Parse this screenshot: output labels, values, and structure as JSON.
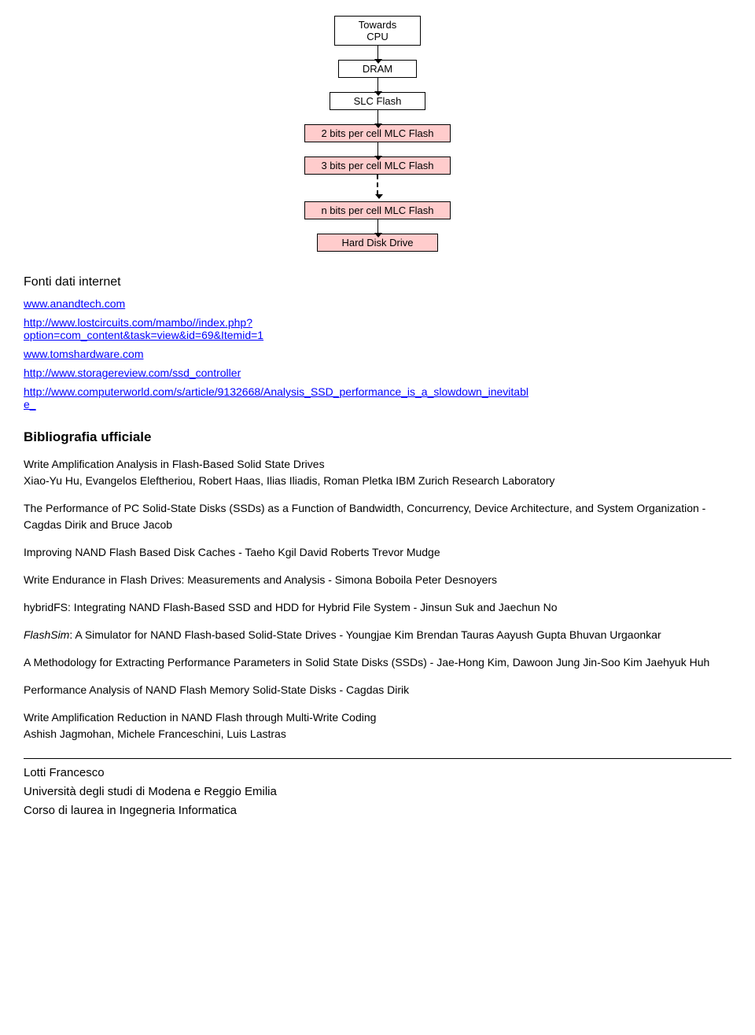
{
  "diagram": {
    "boxes": [
      {
        "id": "cpu",
        "label": "Towards\nCPU",
        "style": "white"
      },
      {
        "id": "dram",
        "label": "DRAM",
        "style": "white"
      },
      {
        "id": "slc",
        "label": "SLC Flash",
        "style": "white"
      },
      {
        "id": "mlc2",
        "label": "2 bits per cell MLC Flash",
        "style": "pink"
      },
      {
        "id": "mlc3",
        "label": "3 bits per cell MLC Flash",
        "style": "pink"
      },
      {
        "id": "nbit",
        "label": "n bits per cell MLC Flash",
        "style": "pink"
      },
      {
        "id": "hdd",
        "label": "Hard Disk Drive",
        "style": "pink"
      }
    ]
  },
  "internet_sources": {
    "heading": "Fonti dati internet",
    "links": [
      "www.anandtech.com",
      "http://www.lostcircuits.com/mambo//index.php?\noption=com_content&task=view&id=69&Itemid=1",
      "www.tomshardware.com",
      "http://www.storagereview.com/ssd_controller",
      "http://www.computerworld.com/s/article/9132668/Analysis_SSD_performance_is_a_slowdown_inevitabl\ne_"
    ]
  },
  "bibliography": {
    "heading": "Bibliografia ufficiale",
    "entries": [
      {
        "title": "Write Amplification Analysis in Flash-Based Solid State Drives",
        "authors": "Xiao-Yu Hu, Evangelos Eleftheriou, Robert Haas, Ilias Iliadis, Roman Pletka IBM Zurich Research Laboratory",
        "italic": false
      },
      {
        "title": "The Performance of PC Solid-State Disks (SSDs) as a Function of Bandwidth, Concurrency, Device Architecture, and System Organization  -  Cagdas Dirik  and Bruce Jacob",
        "authors": "",
        "italic": false
      },
      {
        "title": "Improving NAND Flash Based Disk Caches  -  Taeho Kgil  David Roberts Trevor Mudge",
        "authors": "",
        "italic": false
      },
      {
        "title": "Write Endurance in Flash Drives: Measurements and Analysis   -   Simona Boboila  Peter Desnoyers",
        "authors": "",
        "italic": false
      },
      {
        "title": "hybridFS: Integrating NAND Flash-Based SSD and HDD for Hybrid File System  -  Jinsun Suk and Jaechun No",
        "authors": "",
        "italic": false
      },
      {
        "title_italic": "FlashSim",
        "title_rest": ": A Simulator for NAND Flash-based Solid-State Drives - Youngjae Kim  Brendan Tauras  Aayush Gupta Bhuvan Urgaonkar",
        "italic": true
      },
      {
        "title": "A Methodology for Extracting Performance Parameters in Solid State Disks (SSDs)  -  Jae-Hong Kim, Dawoon Jung Jin-Soo Kim  Jaehyuk Huh",
        "authors": "",
        "italic": false
      },
      {
        "title": "Performance Analysis of NAND Flash Memory Solid-State Disks   -  Cagdas Dirik",
        "authors": "",
        "italic": false
      },
      {
        "title": "Write Amplification Reduction in NAND Flash through Multi-Write Coding\nAshish Jagmohan, Michele Franceschini, Luis Lastras",
        "authors": "",
        "italic": false
      }
    ]
  },
  "footer": {
    "name": "Lotti Francesco",
    "university": "Università degli studi di Modena e Reggio Emilia",
    "degree": "Corso di laurea in Ingegneria Informatica"
  }
}
